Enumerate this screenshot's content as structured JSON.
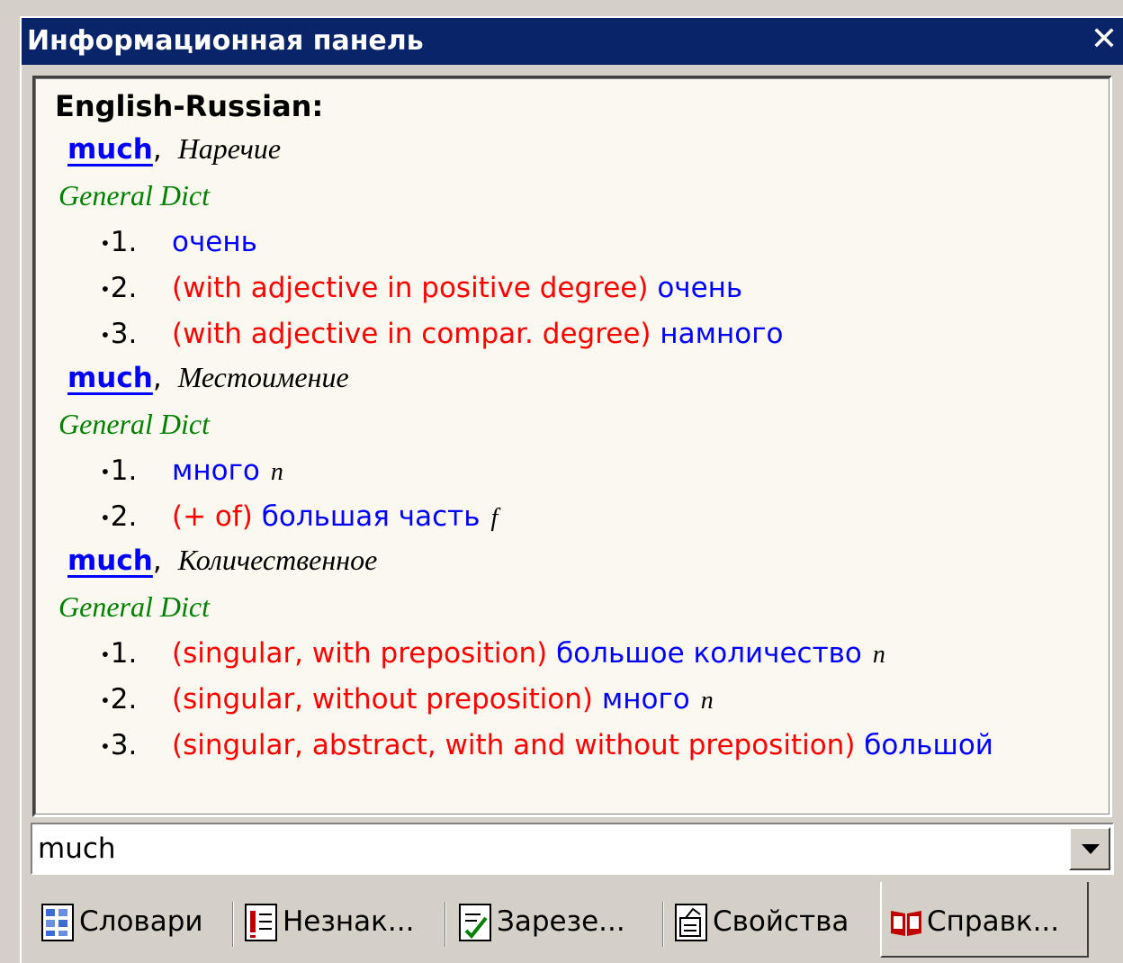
{
  "window": {
    "title": "Информационная панель",
    "close_glyph": "✕"
  },
  "panel": {
    "header": "English-Russian:",
    "entries": [
      {
        "headword": "much",
        "pos": "Наречие",
        "dict": "General Dict",
        "senses": [
          {
            "num": "1.",
            "note": "",
            "translation": "очень",
            "gram": ""
          },
          {
            "num": "2.",
            "note": "(with adjective in positive degree)",
            "translation": "очень",
            "gram": ""
          },
          {
            "num": "3.",
            "note": "(with adjective in compar. degree)",
            "translation": "намного",
            "gram": ""
          }
        ]
      },
      {
        "headword": "much",
        "pos": "Местоимение",
        "dict": "General Dict",
        "senses": [
          {
            "num": "1.",
            "note": "",
            "translation": "много",
            "gram": "n"
          },
          {
            "num": "2.",
            "note": "(+ of)",
            "translation": "большая часть",
            "gram": "f"
          }
        ]
      },
      {
        "headword": "much",
        "pos": "Количественное",
        "dict": "General Dict",
        "senses": [
          {
            "num": "1.",
            "note": "(singular, with preposition)",
            "translation": "большое количество",
            "gram": "n"
          },
          {
            "num": "2.",
            "note": "(singular, without preposition)",
            "translation": "много",
            "gram": "n"
          },
          {
            "num": "3.",
            "note": "(singular, abstract, with and without preposition)",
            "translation": "большой",
            "gram": ""
          }
        ]
      }
    ]
  },
  "search": {
    "value": "much"
  },
  "tabs": [
    {
      "label": "Словари",
      "icon": "dictionaries-icon"
    },
    {
      "label": "Незнак...",
      "icon": "unknown-words-icon"
    },
    {
      "label": "Зарезе...",
      "icon": "reserved-icon"
    },
    {
      "label": "Свойства",
      "icon": "properties-icon"
    },
    {
      "label": "Справк...",
      "icon": "reference-icon",
      "active": true
    }
  ],
  "colors": {
    "titlebar": "#0a246a",
    "headword": "#0000ff",
    "dict": "#008000",
    "note": "#ff0000",
    "translation": "#0000ff",
    "content_bg": "#fbf9ef"
  }
}
